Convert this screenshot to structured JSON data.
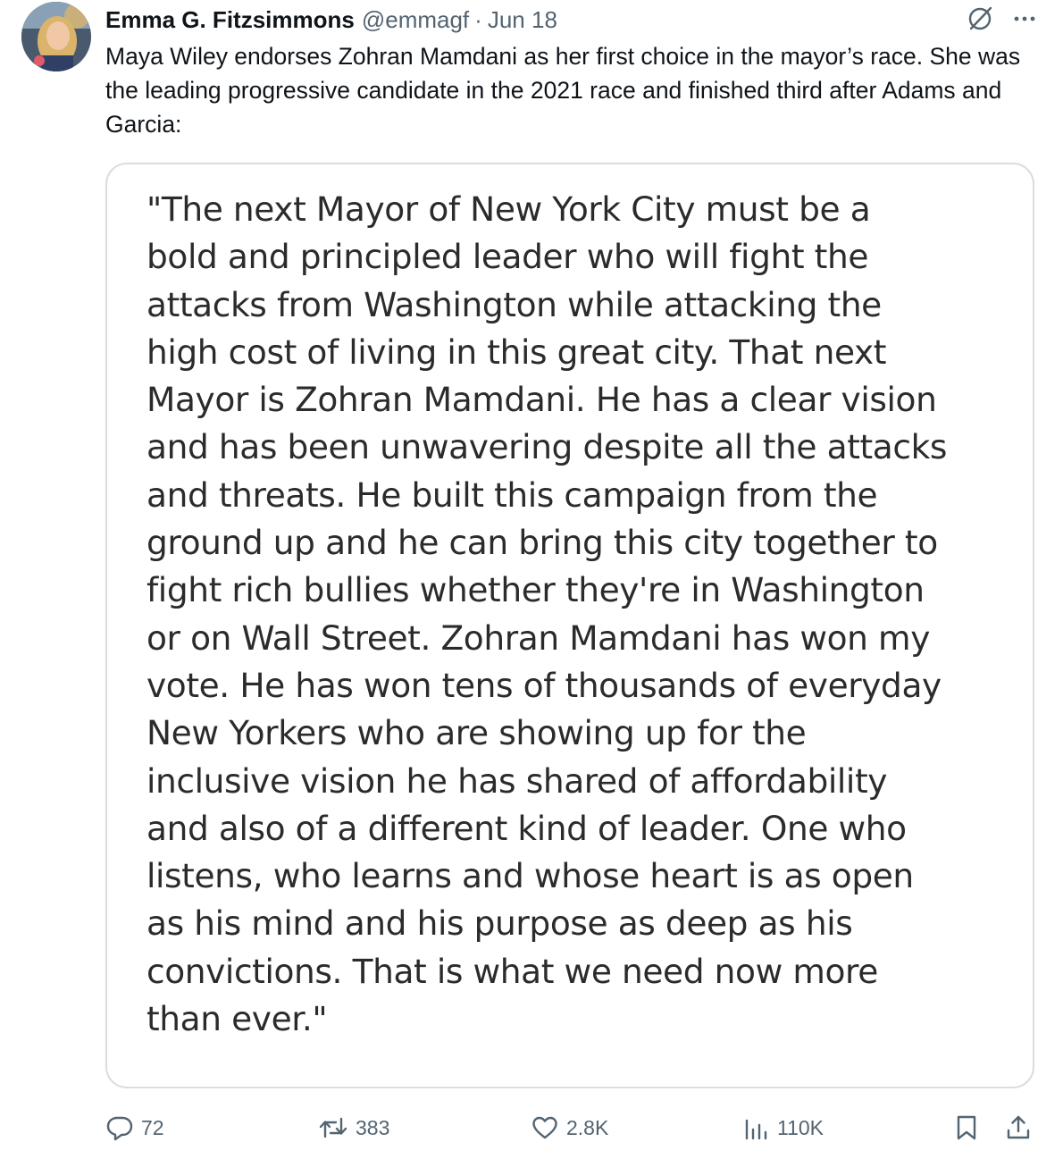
{
  "author": {
    "name": "Emma G. Fitzsimmons",
    "handle": "@emmagf",
    "separator": "·",
    "date": "Jun 18"
  },
  "tweet": {
    "text": "Maya Wiley endorses Zohran Mamdani as her first choice in the mayor’s race. She was the leading progressive candidate in the 2021 race and finished third after Adams and Garcia:"
  },
  "quote_image": {
    "lines": [
      "\"The next Mayor of New York City must be a",
      "bold and principled leader who will fight the",
      "attacks from Washington while attacking the",
      "high cost of living in this great city. That next",
      "Mayor is Zohran Mamdani. He has a clear vision",
      "and has been unwavering despite all the attacks",
      "and threats. He built this campaign from the",
      "ground up and he can bring this city together to",
      "fight rich bullies whether they're in Washington",
      "or on Wall Street. Zohran Mamdani has won my",
      "vote. He has won tens of thousands of everyday",
      "New Yorkers who are showing up for the",
      "inclusive vision he has shared of affordability",
      "and also of a different kind of leader. One who",
      "listens, who learns and whose heart is as open",
      "as his mind and his purpose as deep as his",
      "convictions. That is what we need now more",
      "than ever.\""
    ]
  },
  "actions": {
    "replies": "72",
    "reposts": "383",
    "likes": "2.8K",
    "views": "110K"
  },
  "icons": {
    "grok": "grok-icon",
    "more": "more-icon",
    "reply": "reply-icon",
    "repost": "repost-icon",
    "like": "like-icon",
    "views": "views-icon",
    "bookmark": "bookmark-icon",
    "share": "share-icon"
  },
  "colors": {
    "text": "#0f1419",
    "secondary": "#536471",
    "border": "#d8dde1"
  }
}
